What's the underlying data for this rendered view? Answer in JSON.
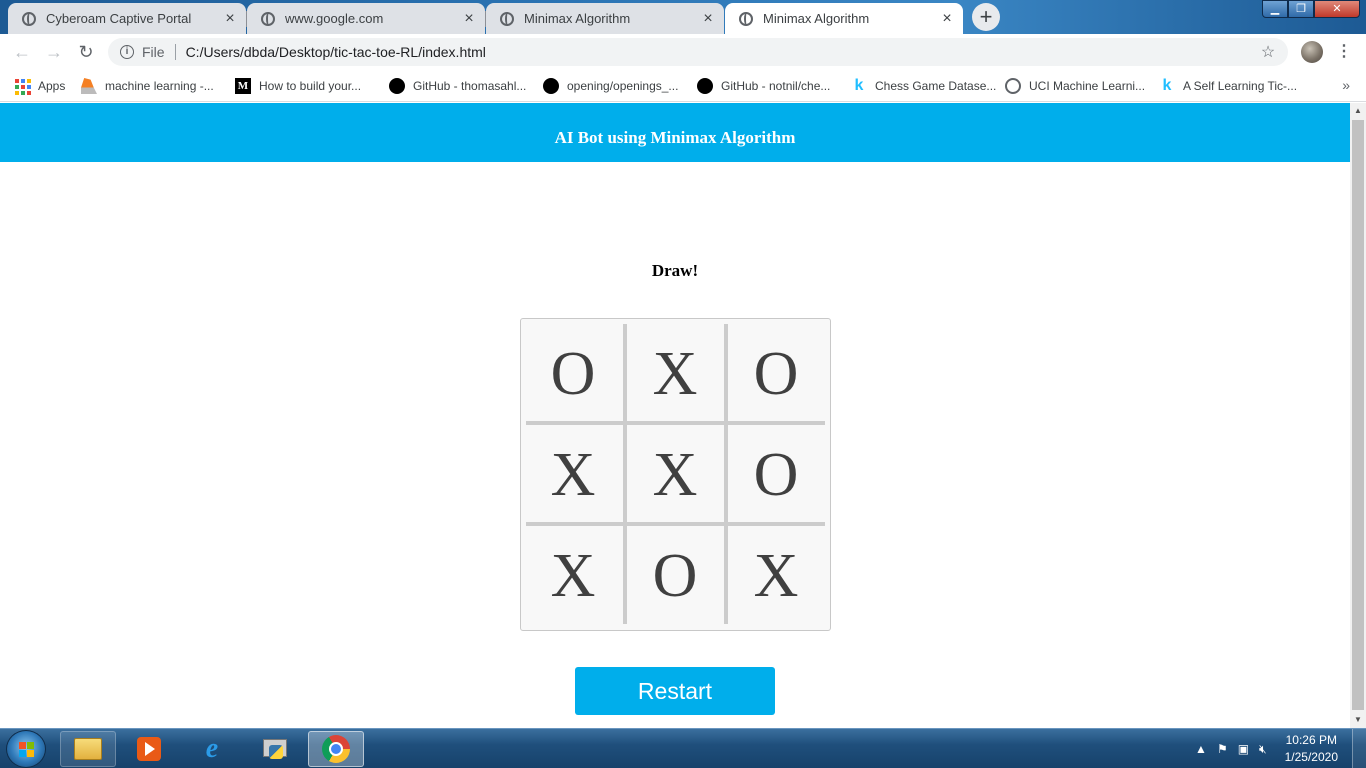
{
  "browser": {
    "tabs": [
      {
        "title": "Cyberoam Captive Portal",
        "close": "×"
      },
      {
        "title": "www.google.com",
        "close": "×"
      },
      {
        "title": "Minimax Algorithm",
        "close": "×"
      },
      {
        "title": "Minimax Algorithm",
        "close": "×"
      }
    ],
    "new_tab": "+",
    "omnibox": {
      "scheme": "File",
      "url": "C:/Users/dbda/Desktop/tic-tac-toe-RL/index.html"
    },
    "bookmarks": [
      {
        "label": "Apps",
        "icon": "apps-grid-icon"
      },
      {
        "label": "machine learning -...",
        "icon": "stackoverflow-icon"
      },
      {
        "label": "How to build your...",
        "icon": "medium-icon"
      },
      {
        "label": "GitHub - thomasahl...",
        "icon": "github-icon"
      },
      {
        "label": "opening/openings_...",
        "icon": "github-icon"
      },
      {
        "label": "GitHub - notnil/che...",
        "icon": "github-icon"
      },
      {
        "label": "Chess Game Datase...",
        "icon": "kaggle-icon"
      },
      {
        "label": "UCI Machine Learni...",
        "icon": "globe-icon"
      },
      {
        "label": "A Self Learning Tic-...",
        "icon": "kaggle-icon"
      }
    ],
    "bookmarks_more": "»"
  },
  "page": {
    "header_title": "AI Bot using Minimax Algorithm",
    "status": "Draw!",
    "board": [
      "O",
      "X",
      "O",
      "X",
      "X",
      "O",
      "X",
      "O",
      "X"
    ],
    "restart_label": "Restart",
    "colors": {
      "accent": "#00aeeb",
      "mark": "#404040",
      "grid": "#cccccc"
    }
  },
  "taskbar": {
    "pinned_apps": [
      "windows-explorer-icon",
      "media-player-icon",
      "internet-explorer-icon",
      "python-idle-icon",
      "chrome-icon"
    ],
    "clock": {
      "time": "10:26 PM",
      "date": "1/25/2020"
    }
  }
}
